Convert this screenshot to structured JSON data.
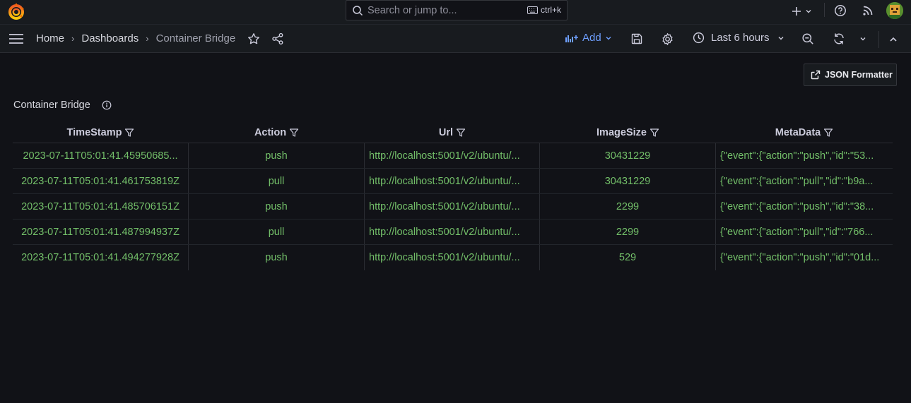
{
  "search": {
    "placeholder": "Search or jump to...",
    "shortcut": "ctrl+k"
  },
  "breadcrumbs": [
    "Home",
    "Dashboards",
    "Container Bridge"
  ],
  "toolbar": {
    "add_label": "Add",
    "time_range": "Last 6 hours"
  },
  "json_button_label": "JSON Formatter",
  "panel": {
    "title": "Container Bridge"
  },
  "table": {
    "columns": [
      "TimeStamp",
      "Action",
      "Url",
      "ImageSize",
      "MetaData"
    ],
    "rows": [
      {
        "timestamp": "2023-07-11T05:01:41.45950685...",
        "action": "push",
        "url": "http://localhost:5001/v2/ubuntu/...",
        "image_size": "30431229",
        "metadata": "{\"event\":{\"action\":\"push\",\"id\":\"53..."
      },
      {
        "timestamp": "2023-07-11T05:01:41.461753819Z",
        "action": "pull",
        "url": "http://localhost:5001/v2/ubuntu/...",
        "image_size": "30431229",
        "metadata": "{\"event\":{\"action\":\"pull\",\"id\":\"b9a..."
      },
      {
        "timestamp": "2023-07-11T05:01:41.485706151Z",
        "action": "push",
        "url": "http://localhost:5001/v2/ubuntu/...",
        "image_size": "2299",
        "metadata": "{\"event\":{\"action\":\"push\",\"id\":\"38..."
      },
      {
        "timestamp": "2023-07-11T05:01:41.487994937Z",
        "action": "pull",
        "url": "http://localhost:5001/v2/ubuntu/...",
        "image_size": "2299",
        "metadata": "{\"event\":{\"action\":\"pull\",\"id\":\"766..."
      },
      {
        "timestamp": "2023-07-11T05:01:41.494277928Z",
        "action": "push",
        "url": "http://localhost:5001/v2/ubuntu/...",
        "image_size": "529",
        "metadata": "{\"event\":{\"action\":\"push\",\"id\":\"01d..."
      }
    ]
  },
  "colors": {
    "background": "#111217",
    "bar": "#181b1f",
    "cell_text": "#73bf69",
    "accent": "#6e9fff",
    "logo": "#f46800"
  },
  "icons": {
    "logo": "grafana-logo-icon",
    "search": "search-icon",
    "keyboard": "keyboard-icon",
    "plus": "plus-icon",
    "help": "help-icon",
    "news": "rss-icon",
    "menu": "hamburger-icon",
    "star": "star-icon",
    "share": "share-icon",
    "save": "save-icon",
    "settings": "gear-icon",
    "clock": "clock-icon",
    "zoom_out": "zoom-out-icon",
    "refresh": "refresh-icon",
    "collapse": "chevron-up-icon",
    "filter": "filter-icon",
    "external": "external-link-icon",
    "info": "info-icon"
  }
}
